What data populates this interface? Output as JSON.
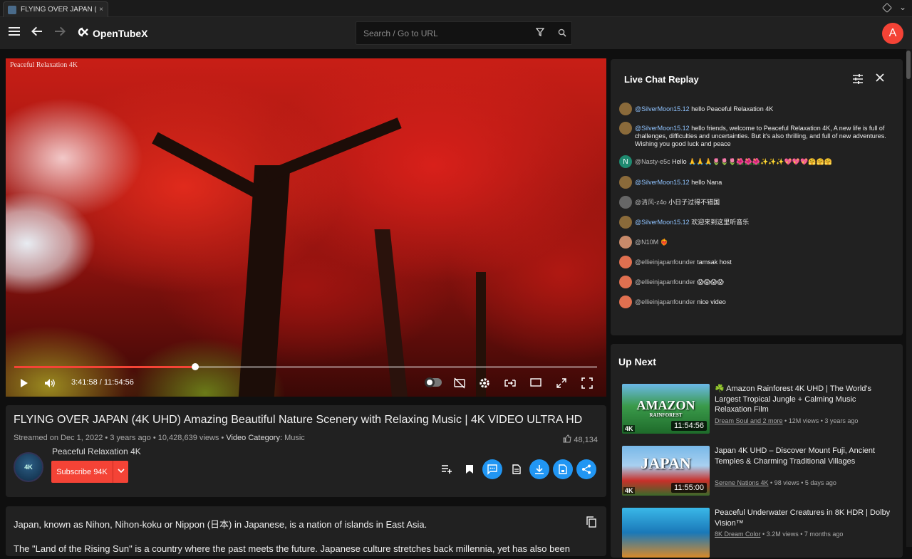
{
  "browser": {
    "tab_title": "FLYING OVER JAPAN (...",
    "tab_close": "×"
  },
  "header": {
    "app_name": "OpenTubeX",
    "search_placeholder": "Search / Go to URL",
    "avatar_letter": "A"
  },
  "player": {
    "watermark": "Peaceful Relaxation 4K",
    "current_time": "3:41:58",
    "duration": "11:54:56",
    "time_display": "3:41:58 / 11:54:56",
    "progress_fraction": 0.31
  },
  "video": {
    "title": "FLYING OVER JAPAN (4K UHD) Amazing Beautiful Nature Scenery with Relaxing Music | 4K VIDEO ULTRA HD",
    "streamed": "Streamed on Dec 1, 2022 • 3 years ago • 10,428,639 views • ",
    "category_label": "Video Category:",
    "category_value": " Music",
    "likes": "48,134",
    "channel_name": "Peaceful Relaxation 4K",
    "channel_avatar_text": "4K",
    "subscribe_label": "Subscribe 94K"
  },
  "description": {
    "line1": "Japan, known as Nihon, Nihon-koku or Nippon (日本) in Japanese, is a nation of islands in East Asia.",
    "line2": "The \"Land of the Rising Sun\" is a country where the past meets the future. Japanese culture stretches back millennia, yet has also been"
  },
  "chat": {
    "title": "Live Chat Replay",
    "messages": [
      {
        "user": "@SilverMoon15.12",
        "text": "hello Peaceful Relaxation 4K",
        "highlight": true,
        "avatar_color": "#8a6a3a"
      },
      {
        "user": "@SilverMoon15.12",
        "text": "hello friends, welcome to Peaceful Relaxation 4K, A new life is full of challenges, difficulties and uncertainties. But it's also thrilling, and full of new adventures. Wishing you good luck and peace",
        "highlight": true,
        "avatar_color": "#8a6a3a"
      },
      {
        "user": "@Nasty-e5c",
        "text": "Hello 🙏🙏🙏🌷🌷🌷🌺🌺🌺✨✨✨💖💖💖🤗🤗🤗",
        "highlight": false,
        "avatar_color": "#1f8a70",
        "avatar_letter": "N"
      },
      {
        "user": "@SilverMoon15.12",
        "text": "hello Nana",
        "highlight": true,
        "avatar_color": "#8a6a3a"
      },
      {
        "user": "@清风-z4o",
        "text": "小日子过得不错国",
        "highlight": false,
        "avatar_color": "#666666"
      },
      {
        "user": "@SilverMoon15.12",
        "text": "欢迎来到这里听音乐",
        "highlight": true,
        "avatar_color": "#8a6a3a"
      },
      {
        "user": "@N10M",
        "text": "❤️‍🔥",
        "highlight": false,
        "avatar_color": "#c88a6a"
      },
      {
        "user": "@ellieinjapanfounder",
        "text": "tamsak host",
        "highlight": false,
        "avatar_color": "#e07050"
      },
      {
        "user": "@ellieinjapanfounder",
        "text": "😱😱😱😱",
        "highlight": false,
        "avatar_color": "#e07050"
      },
      {
        "user": "@ellieinjapanfounder",
        "text": "nice video",
        "highlight": false,
        "avatar_color": "#e07050"
      }
    ]
  },
  "upnext": {
    "title": "Up Next",
    "items": [
      {
        "title": "☘️ Amazon Rainforest 4K UHD | The World's Largest Tropical Jungle + Calming Music Relaxation Film",
        "channel": "Dream Soul and 2 more",
        "meta": " • 12M views • 3 years ago",
        "duration": "11:54:56",
        "thumb_text": "AMAZON",
        "thumb_sub": "RAINFOREST",
        "badge": "4K"
      },
      {
        "title": "Japan 4K UHD – Discover Mount Fuji, Ancient Temples & Charming Traditional Villages",
        "channel": "Serene Nations 4K",
        "meta": " • 98 views • 5 days ago",
        "duration": "11:55:00",
        "thumb_text": "JAPAN",
        "thumb_sub": "",
        "badge": "4K"
      },
      {
        "title": "Peaceful Underwater Creatures in 8K HDR | Dolby Vision™",
        "channel": "8K Dream Color",
        "meta": " • 3.2M views • 7 months ago",
        "duration": "",
        "thumb_text": "",
        "thumb_sub": "",
        "badge": ""
      }
    ]
  },
  "colors": {
    "accent_red": "#f44336",
    "accent_blue": "#2196f3",
    "link_blue": "#8fc3ff"
  }
}
